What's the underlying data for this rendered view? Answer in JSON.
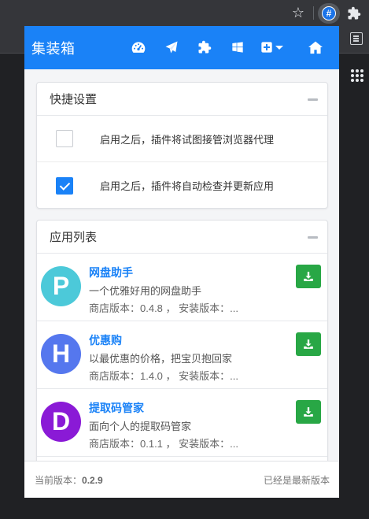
{
  "browser": {
    "star_icon": "star-icon",
    "active_extension_label": "#",
    "puzzle_icon": "puzzle-icon",
    "apps_icon": "apps-grid-icon"
  },
  "navbar": {
    "brand": "集装箱",
    "icons": [
      "dashboard-icon",
      "paper-plane-icon",
      "puzzle-piece-icon",
      "windows-icon",
      "plus-square-icon",
      "chevron-down-icon",
      "home-icon"
    ],
    "color": "#1a82f7"
  },
  "quick_settings": {
    "title": "快捷设置",
    "items": [
      {
        "label": "启用之后，插件将试图接管浏览器代理",
        "checked": false
      },
      {
        "label": "启用之后，插件将自动检查并更新应用",
        "checked": true
      }
    ]
  },
  "app_list": {
    "title": "应用列表",
    "apps": [
      {
        "letter": "P",
        "name": "网盘助手",
        "description": "一个优雅好用的网盘助手",
        "version_text": "商店版本：0.4.8 ， 安装版本：...",
        "color": "#4cc9d9"
      },
      {
        "letter": "H",
        "name": "优惠购",
        "description": "以最优惠的价格，把宝贝抱回家",
        "version_text": "商店版本：1.4.0 ， 安装版本：...",
        "color": "#5577ee"
      },
      {
        "letter": "D",
        "name": "提取码管家",
        "description": "面向个人的提取码管家",
        "version_text": "商店版本：0.1.1 ， 安装版本：...",
        "color": "#8a1ad6"
      }
    ],
    "download_color": "#28a745"
  },
  "footer": {
    "version_label": "当前版本：",
    "version_value": "0.2.9",
    "status": "已经是最新版本"
  }
}
